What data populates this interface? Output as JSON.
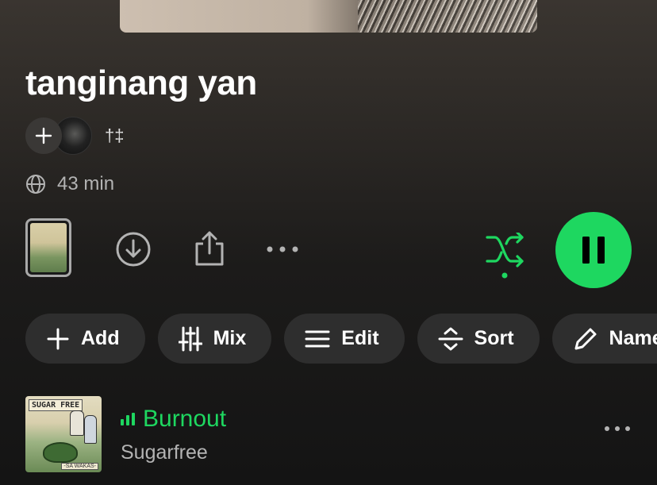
{
  "playlist": {
    "title": "tanginang yan",
    "owner_name": "†‡",
    "duration": "43 min"
  },
  "controls": {
    "icons": [
      "download-icon",
      "share-icon",
      "more-options-icon",
      "shuffle-icon",
      "pause-icon"
    ],
    "accent_color": "#1ed760",
    "shuffle_active": true,
    "playing": true
  },
  "actions": [
    {
      "label": "Add",
      "icon": "plus-icon"
    },
    {
      "label": "Mix",
      "icon": "sliders-icon"
    },
    {
      "label": "Edit",
      "icon": "list-icon"
    },
    {
      "label": "Sort",
      "icon": "sort-icon"
    },
    {
      "label": "Name",
      "icon": "pencil-icon"
    }
  ],
  "tracks": [
    {
      "title": "Burnout",
      "artist": "Sugarfree",
      "now_playing": true,
      "cover_logo_text": "SUGAR FREE",
      "cover_tag_text": "-SA WAKAS-"
    }
  ]
}
